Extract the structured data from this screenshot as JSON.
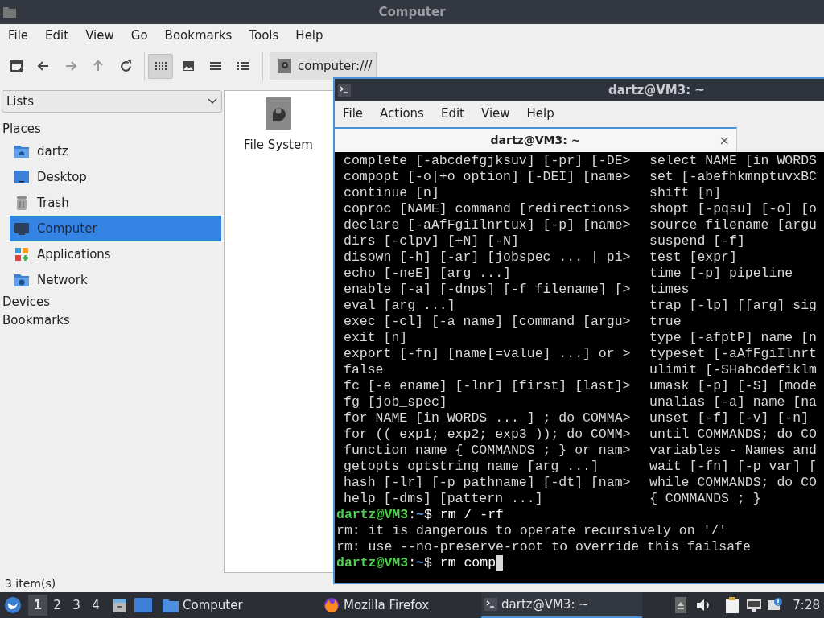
{
  "file_manager": {
    "title": "Computer",
    "menu": [
      "File",
      "Edit",
      "View",
      "Go",
      "Bookmarks",
      "Tools",
      "Help"
    ],
    "view_modes": [
      {
        "selected": true
      },
      {
        "selected": false
      },
      {
        "selected": false
      },
      {
        "selected": false
      }
    ],
    "location": "computer:///",
    "side_pane": {
      "mode": "Lists",
      "sections": [
        {
          "title": "Places",
          "items": [
            {
              "label": "dartz",
              "selected": false
            },
            {
              "label": "Desktop",
              "selected": false
            },
            {
              "label": "Trash",
              "selected": false
            },
            {
              "label": "Computer",
              "selected": true
            },
            {
              "label": "Applications",
              "selected": false
            },
            {
              "label": "Network",
              "selected": false
            }
          ]
        },
        {
          "title": "Devices"
        },
        {
          "title": "Bookmarks"
        }
      ]
    },
    "items": [
      {
        "label": "File System"
      }
    ],
    "status": "3 item(s)"
  },
  "terminal": {
    "title": "dartz@VM3: ~",
    "menu": [
      "File",
      "Actions",
      "Edit",
      "View",
      "Help"
    ],
    "tab": "dartz@VM3: ~",
    "tab_close": "×",
    "help_rows": [
      {
        "left": "complete [-abcdefgjksuv] [-pr] [-DE>",
        "right": "select NAME [in WORDS"
      },
      {
        "left": "compopt [-o|+o option] [-DEI] [name>",
        "right": "set [-abefhkmnptuvxBC"
      },
      {
        "left": "continue [n]",
        "right": "shift [n]"
      },
      {
        "left": "coproc [NAME] command [redirections>",
        "right": "shopt [-pqsu] [-o] [o"
      },
      {
        "left": "declare [-aAfFgiIlnrtux] [-p] [name>",
        "right": "source filename [argu"
      },
      {
        "left": "dirs [-clpv] [+N] [-N]",
        "right": "suspend [-f]"
      },
      {
        "left": "disown [-h] [-ar] [jobspec ... | pi>",
        "right": "test [expr]"
      },
      {
        "left": "echo [-neE] [arg ...]",
        "right": "time [-p] pipeline"
      },
      {
        "left": "enable [-a] [-dnps] [-f filename] [>",
        "right": "times"
      },
      {
        "left": "eval [arg ...]",
        "right": "trap [-lp] [[arg] sig"
      },
      {
        "left": "exec [-cl] [-a name] [command [argu>",
        "right": "true"
      },
      {
        "left": "exit [n]",
        "right": "type [-afptP] name [n"
      },
      {
        "left": "export [-fn] [name[=value] ...] or >",
        "right": "typeset [-aAfFgiIlnrt"
      },
      {
        "left": "false",
        "right": "ulimit [-SHabcdefiklm"
      },
      {
        "left": "fc [-e ename] [-lnr] [first] [last]>",
        "right": "umask [-p] [-S] [mode"
      },
      {
        "left": "fg [job_spec]",
        "right": "unalias [-a] name [na"
      },
      {
        "left": "for NAME [in WORDS ... ] ; do COMMA>",
        "right": "unset [-f] [-v] [-n]"
      },
      {
        "left": "for (( exp1; exp2; exp3 )); do COMM>",
        "right": "until COMMANDS; do CO"
      },
      {
        "left": "function name { COMMANDS ; } or nam>",
        "right": "variables - Names and"
      },
      {
        "left": "getopts optstring name [arg ...]",
        "right": "wait [-fn] [-p var] ["
      },
      {
        "left": "hash [-lr] [-p pathname] [-dt] [nam>",
        "right": "while COMMANDS; do CO"
      },
      {
        "left": "help [-dms] [pattern ...]",
        "right": "{ COMMANDS ; }"
      }
    ],
    "session": [
      {
        "kind": "prompt",
        "user": "dartz@VM3",
        "sep": ":",
        "path": "~",
        "sign": "$",
        "command": "rm / -rf",
        "cursor": false
      },
      {
        "kind": "output",
        "text": "rm: it is dangerous to operate recursively on '/'"
      },
      {
        "kind": "output",
        "text": "rm: use --no-preserve-root to override this failsafe"
      },
      {
        "kind": "prompt",
        "user": "dartz@VM3",
        "sep": ":",
        "path": "~",
        "sign": "$",
        "command": "rm comp",
        "cursor": true
      }
    ]
  },
  "taskbar": {
    "workspaces": [
      {
        "label": "1",
        "selected": true
      },
      {
        "label": "2",
        "selected": false
      },
      {
        "label": "3",
        "selected": false
      },
      {
        "label": "4",
        "selected": false
      }
    ],
    "tasks": [
      {
        "label": "Computer",
        "selected": false
      },
      {
        "label": "Mozilla Firefox",
        "selected": false
      },
      {
        "label": "dartz@VM3: ~",
        "selected": true
      }
    ],
    "clock": "7:28"
  }
}
